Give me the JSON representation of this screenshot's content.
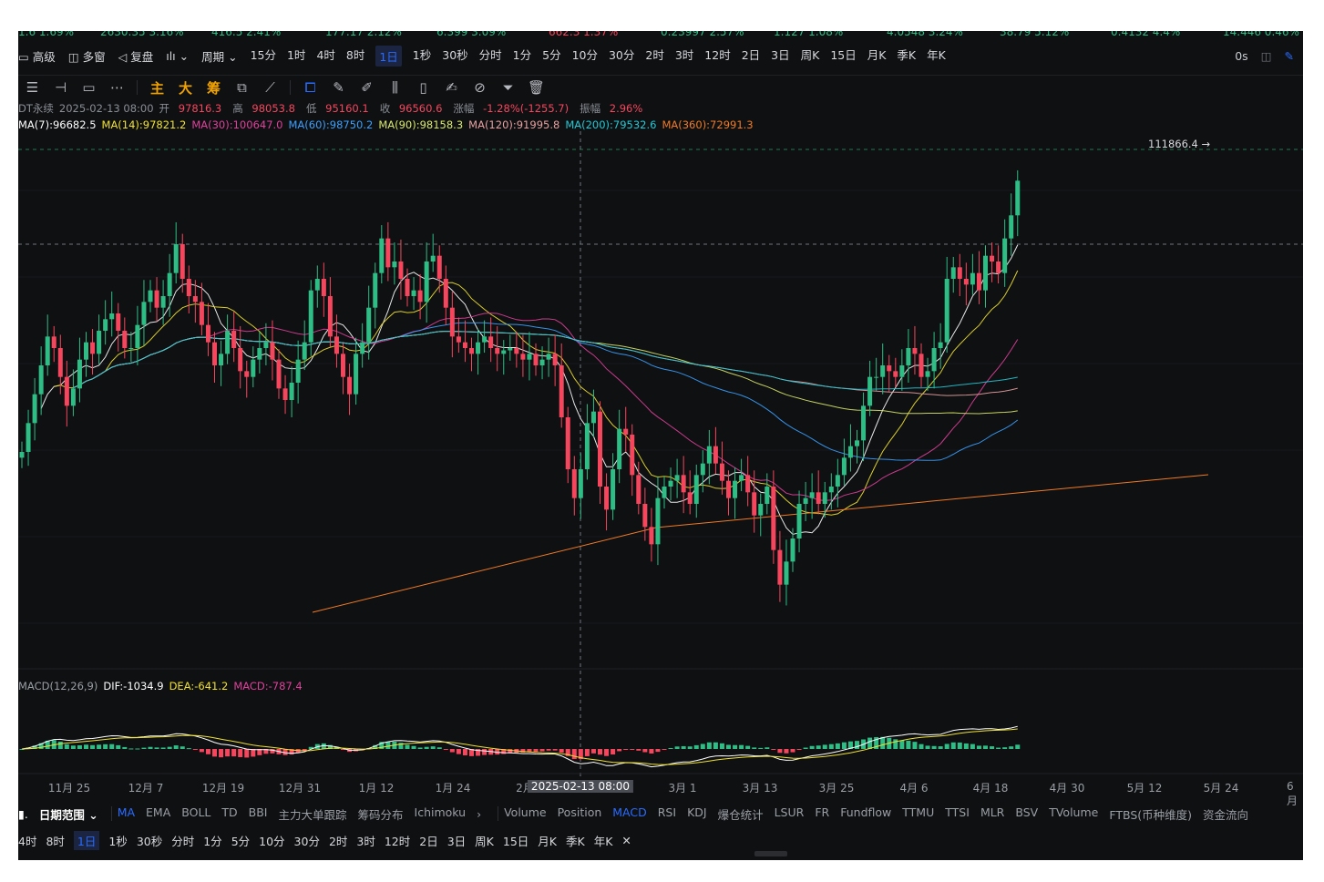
{
  "ticker": [
    {
      "text": "1.6 1.69%",
      "color": "green"
    },
    {
      "text": "2630.35 3.16%",
      "color": "green"
    },
    {
      "text": "416.5 2.41%",
      "color": "green"
    },
    {
      "text": "177.17 2.12%",
      "color": "green"
    },
    {
      "text": "6.399 3.09%",
      "color": "green"
    },
    {
      "text": "662.3 1.37%",
      "color": "red"
    },
    {
      "text": "0.23997 2.57%",
      "color": "green"
    },
    {
      "text": "1.127 1.08%",
      "color": "green"
    },
    {
      "text": "4.0548 3.24%",
      "color": "green"
    },
    {
      "text": "38.79 5.12%",
      "color": "green"
    },
    {
      "text": "0.4132 4.4%",
      "color": "green"
    },
    {
      "text": "14.446 0.46%",
      "color": "green"
    }
  ],
  "toolbar": {
    "tools": [
      "高级",
      "多窗",
      "复盘",
      "周期"
    ],
    "timeframes": [
      "15分",
      "1时",
      "4时",
      "8时",
      "1日",
      "1秒",
      "30秒",
      "分时",
      "1分",
      "5分",
      "10分",
      "30分",
      "2时",
      "3时",
      "12时",
      "2日",
      "3日",
      "周K",
      "15日",
      "月K",
      "季K",
      "年K"
    ],
    "active_timeframe": "1日",
    "right_label": "0s"
  },
  "drawing_tools": {
    "letters": [
      "主",
      "大",
      "筹"
    ]
  },
  "ohlc": {
    "symbol": "DT永续",
    "date": "2025-02-13 08:00",
    "open_label": "开",
    "open": "97816.3",
    "high_label": "高",
    "high": "98053.8",
    "low_label": "低",
    "low": "95160.1",
    "close_label": "收",
    "close": "96560.6",
    "change_label": "涨幅",
    "change": "-1.28%(-1255.7)",
    "amp_label": "振幅",
    "amp": "2.96%"
  },
  "ma_indicators": [
    {
      "text": "MA(7):96682.5",
      "color": "#ffffff"
    },
    {
      "text": "MA(14):97821.2",
      "color": "#f0e130"
    },
    {
      "text": "MA(30):100647.0",
      "color": "#e0409b"
    },
    {
      "text": "MA(60):98750.2",
      "color": "#3aa0ff"
    },
    {
      "text": "MA(90):98158.3",
      "color": "#d8e86a"
    },
    {
      "text": "MA(120):91995.8",
      "color": "#e8a0a0"
    },
    {
      "text": "MA(200):79532.6",
      "color": "#22c9d6"
    },
    {
      "text": "MA(360):72991.3",
      "color": "#f07a25"
    }
  ],
  "colors": {
    "up": "#2ebd85",
    "down": "#f6465d",
    "accent": "#2a6bff",
    "background": "#0f1012"
  },
  "chart_data": {
    "type": "candlestick",
    "last_price_label": "111866.4 →",
    "macd": {
      "label": "MACD(12,26,9)",
      "dif": "DIF:-1034.9",
      "dea": "DEA:-641.2",
      "macd": "MACD:-787.4"
    },
    "x_tick_labels": [
      "11月 25",
      "12月 7",
      "12月 19",
      "12月 31",
      "1月 12",
      "1月 24",
      "2月",
      "3月 1",
      "3月 13",
      "3月 25",
      "4月 6",
      "4月 18",
      "4月 30",
      "5月 12",
      "5月 24",
      "6月"
    ],
    "crosshair_date": "2025-02-13 08:00",
    "candles_close_approx": [
      88000,
      90500,
      93000,
      95500,
      98000,
      97000,
      94500,
      92000,
      93500,
      96000,
      97500,
      96500,
      98500,
      99500,
      100000,
      98500,
      97000,
      97000,
      99000,
      101000,
      102000,
      100500,
      101500,
      103500,
      106000,
      103000,
      101500,
      101000,
      99000,
      97500,
      95500,
      96500,
      98500,
      97000,
      95000,
      94500,
      96000,
      97000,
      97500,
      96000,
      93500,
      92500,
      94000,
      96000,
      97500,
      102000,
      103000,
      101500,
      98000,
      96500,
      94500,
      93000,
      96500,
      97500,
      100500,
      103500,
      106500,
      104000,
      104500,
      103000,
      101500,
      102000,
      101000,
      104500,
      105000,
      103000,
      100500,
      98000,
      97500,
      97000,
      96500,
      97500,
      98000,
      97000,
      96500,
      96800,
      97000,
      96500,
      96000,
      96500,
      95500,
      96000,
      96500,
      95500,
      91000,
      86500,
      84000,
      86500,
      90500,
      91500,
      85000,
      83000,
      86500,
      90000,
      89500,
      86000,
      83500,
      81500,
      80000,
      84000,
      85000,
      85500,
      86000,
      84500,
      83500,
      86000,
      87000,
      88500,
      87000,
      85500,
      84000,
      85500,
      86000,
      84500,
      82500,
      83500,
      85000,
      79500,
      76500,
      78500,
      80500,
      83500,
      84000,
      84500,
      83500,
      84500,
      85000,
      86000,
      87500,
      88500,
      89000,
      92000,
      94500,
      94500,
      95500,
      95000,
      94500,
      95500,
      97000,
      96500,
      94500,
      95000,
      97000,
      97500,
      103000,
      104000,
      103000,
      102500,
      103500,
      102000,
      105000,
      104500,
      103500,
      106500,
      108500,
      111500
    ]
  }
}
